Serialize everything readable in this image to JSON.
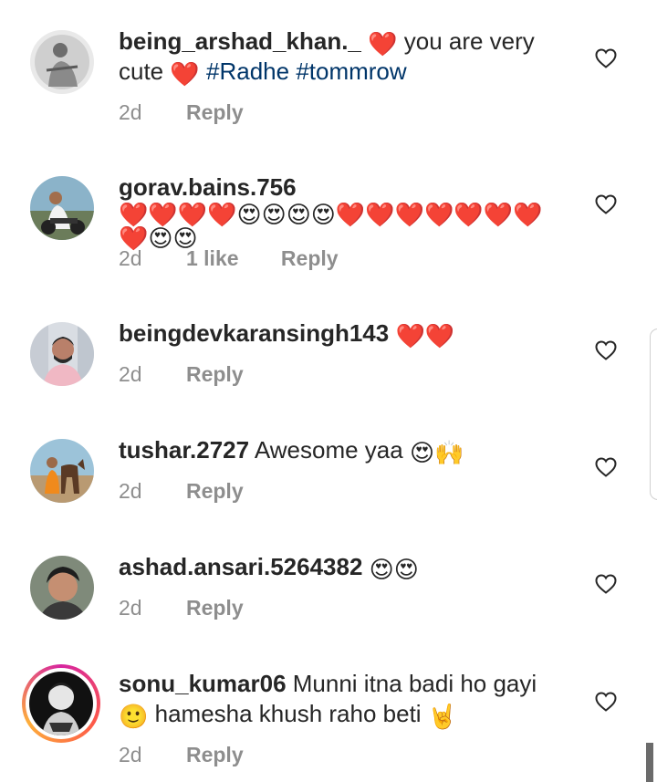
{
  "comments": [
    {
      "username": "being_arshad_khan._",
      "text_before": "",
      "text": "you are very cute",
      "hashtags": [
        "#Radhe",
        "#tommrow"
      ],
      "emojis_before": [
        "❤️"
      ],
      "emojis_after": [
        "❤️"
      ],
      "time": "2d",
      "likes": "",
      "reply": "Reply"
    },
    {
      "username": "gorav.bains.756",
      "text": "",
      "emoji_line": "❤️❤️❤️❤️😍😍😍😍❤️❤️❤️❤️❤️❤️❤️❤️😍😍",
      "time": "2d",
      "likes": "1 like",
      "reply": "Reply"
    },
    {
      "username": "beingdevkaransingh143",
      "text": "",
      "emoji_line": "❤️❤️",
      "time": "2d",
      "likes": "",
      "reply": "Reply"
    },
    {
      "username": "tushar.2727",
      "text": "Awesome yaa",
      "emoji_line": "😍🙌",
      "time": "2d",
      "likes": "",
      "reply": "Reply"
    },
    {
      "username": "ashad.ansari.5264382",
      "text": "",
      "emoji_line": "😍😍",
      "time": "2d",
      "likes": "",
      "reply": "Reply"
    },
    {
      "username": "sonu_kumar06",
      "text": "Munni itna badi ho gayi",
      "emoji_mid": "🙂",
      "text_after": "hamesha khush raho beti",
      "emoji_end": "🤘",
      "time": "2d",
      "likes": "",
      "reply": "Reply"
    }
  ],
  "colors": {
    "username": "#262626",
    "meta": "#8e8e8e",
    "hashtag": "#003569"
  },
  "icons": {
    "like": "heart-outline-icon"
  }
}
